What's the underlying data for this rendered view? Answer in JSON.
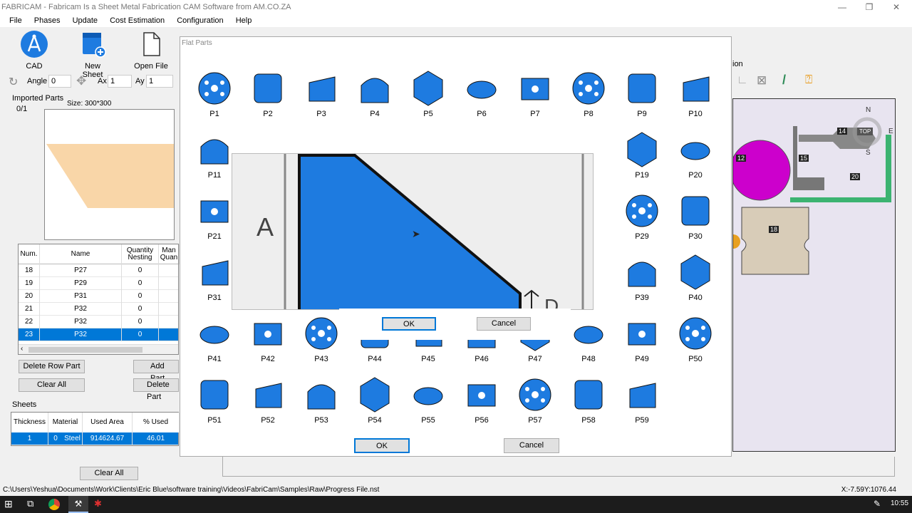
{
  "window": {
    "title": "FABRICAM - Fabricam Is a Sheet Metal Fabrication CAM Software from AM.CO.ZA",
    "min": "—",
    "max": "❐",
    "close": "✕"
  },
  "menu": [
    "File",
    "Phases",
    "Update",
    "Cost Estimation",
    "Configuration",
    "Help"
  ],
  "toolbar": {
    "cad": "CAD",
    "new_sheet": "New Sheet",
    "open_file": "Open File"
  },
  "controls": {
    "angle_label": "Angle",
    "angle_value": "0",
    "ax_label": "Ax",
    "ax_value": "1",
    "ay_label": "Ay",
    "ay_value": "1"
  },
  "imported": {
    "label": "Imported Parts",
    "count": "0/1",
    "size": "Size: 300*300"
  },
  "parts_table": {
    "headers": [
      "Num.",
      "Name",
      "Quantity Nesting",
      "Man Quan"
    ],
    "rows": [
      [
        "18",
        "P27",
        "0"
      ],
      [
        "19",
        "P29",
        "0"
      ],
      [
        "20",
        "P31",
        "0"
      ],
      [
        "21",
        "P32",
        "0"
      ],
      [
        "22",
        "P32",
        "0"
      ],
      [
        "23",
        "P32",
        "0"
      ]
    ]
  },
  "buttons": {
    "delete_row": "Delete Row Part",
    "add_part": "Add Part",
    "clear_all": "Clear All",
    "delete_part": "Delete Part",
    "clear_all2": "Clear All"
  },
  "sheets": {
    "label": "Sheets",
    "headers": [
      "Thickness",
      "Material",
      "Used Area",
      "% Used"
    ],
    "row": [
      "1",
      "0",
      "Steel",
      "914624.67",
      "46.01"
    ]
  },
  "status": {
    "path": "C:\\Users\\Yeshua\\Documents\\Work\\Clients\\Eric Blue\\software training\\Videos\\FabriCam\\Samples\\Raw\\Progress File.nst",
    "coords": "X:-7.59Y:1076.44"
  },
  "taskbar": {
    "time": "10:55"
  },
  "dialog": {
    "title": "Flat Parts",
    "ok": "OK",
    "cancel": "Cancel",
    "parts": [
      "P1",
      "P2",
      "P3",
      "P4",
      "P5",
      "P6",
      "P7",
      "P8",
      "P9",
      "P10",
      "P11",
      "P19",
      "P20",
      "P21",
      "P29",
      "P30",
      "P31",
      "P39",
      "P40",
      "P41",
      "P42",
      "P43",
      "P44",
      "P45",
      "P46",
      "P47",
      "P48",
      "P49",
      "P50",
      "P51",
      "P52",
      "P53",
      "P54",
      "P55",
      "P56",
      "P57",
      "P58",
      "P59"
    ]
  },
  "popup": {
    "letter_a": "A",
    "letter_d": "D",
    "ok": "OK",
    "cancel": "Cancel"
  },
  "canvas": {
    "labels": [
      "12",
      "14",
      "15",
      "18",
      "20"
    ],
    "compass_n": "N",
    "compass_s": "S",
    "compass_e": "E",
    "compass_top": "TOP",
    "right_label": "ion"
  },
  "colors": {
    "part_blue": "#1e7be0",
    "selection": "#0078d7",
    "magenta": "#cc00cc",
    "green": "#3cb371",
    "tan": "#d8ccb8"
  }
}
